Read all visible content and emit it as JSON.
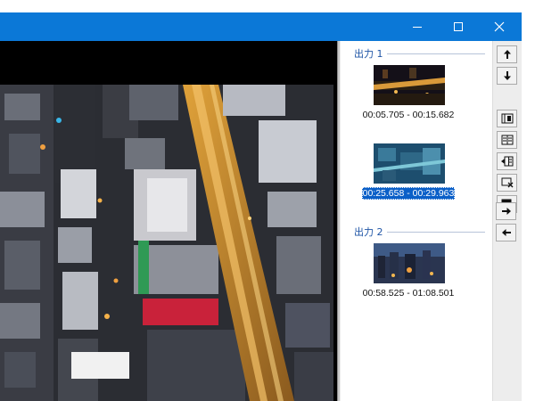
{
  "window": {
    "controls": {
      "minimize_icon": "minimize-icon",
      "maximize_icon": "maximize-icon",
      "close_icon": "close-icon"
    },
    "accent_color": "#0b78d7"
  },
  "clip_list": {
    "groups": [
      {
        "label": "出力 1",
        "clips": [
          {
            "time_range": "00:05.705 - 00:15.682",
            "selected": false
          },
          {
            "time_range": "00:25.658 - 00:29.963",
            "selected": true
          }
        ]
      },
      {
        "label": "出力 2",
        "clips": [
          {
            "time_range": "00:58.525 - 01:08.501",
            "selected": false
          }
        ]
      }
    ],
    "selection_color": "#0a5fc8",
    "header_color": "#1f55a6"
  },
  "toolbar": {
    "buttons": [
      {
        "icon": "arrow-up-icon"
      },
      {
        "icon": "arrow-down-icon"
      },
      {
        "icon": "split-clip-icon"
      },
      {
        "icon": "merge-clip-icon"
      },
      {
        "icon": "merge-into-clip-icon"
      },
      {
        "icon": "delete-clip-icon"
      },
      {
        "icon": "delete-group-icon"
      },
      {
        "icon": "arrow-right-icon"
      },
      {
        "icon": "arrow-left-icon"
      }
    ]
  }
}
